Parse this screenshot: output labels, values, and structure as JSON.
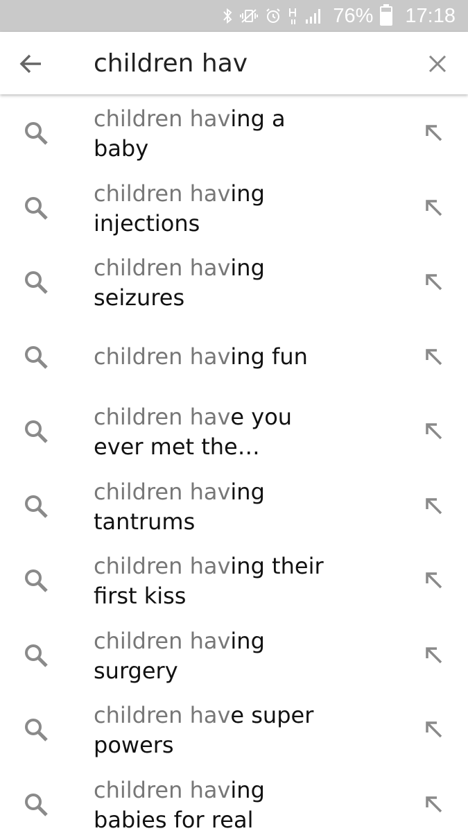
{
  "status_bar": {
    "battery": "76%",
    "time": "17:18",
    "icons": [
      "bluetooth-icon",
      "mute-vibrate-icon",
      "alarm-icon",
      "hplus-data-icon",
      "signal-icon",
      "battery-icon"
    ]
  },
  "search": {
    "query": "children hav",
    "back_icon": "arrow-left-icon",
    "clear_icon": "close-icon"
  },
  "suggestions": [
    {
      "prefix": "children hav",
      "rest_line1": "ing a",
      "line2": "baby"
    },
    {
      "prefix": "children hav",
      "rest_line1": "ing",
      "line2": "injections"
    },
    {
      "prefix": "children hav",
      "rest_line1": "ing",
      "line2": "seizures"
    },
    {
      "prefix": "children hav",
      "rest_line1": "ing fun",
      "line2": ""
    },
    {
      "prefix": "children hav",
      "rest_line1": "e you",
      "line2": "ever met the…"
    },
    {
      "prefix": "children hav",
      "rest_line1": "ing",
      "line2": "tantrums"
    },
    {
      "prefix": "children hav",
      "rest_line1": "ing their",
      "line2": "first kiss"
    },
    {
      "prefix": "children hav",
      "rest_line1": "ing",
      "line2": "surgery"
    },
    {
      "prefix": "children hav",
      "rest_line1": "e super",
      "line2": "powers"
    },
    {
      "prefix": "children hav",
      "rest_line1": "ing",
      "line2": "babies for real"
    }
  ],
  "colors": {
    "status_bar_bg": "#c9c9c9",
    "prefix_text": "#777777",
    "completion_text": "#111111",
    "icon_gray": "#8a8a8a"
  }
}
